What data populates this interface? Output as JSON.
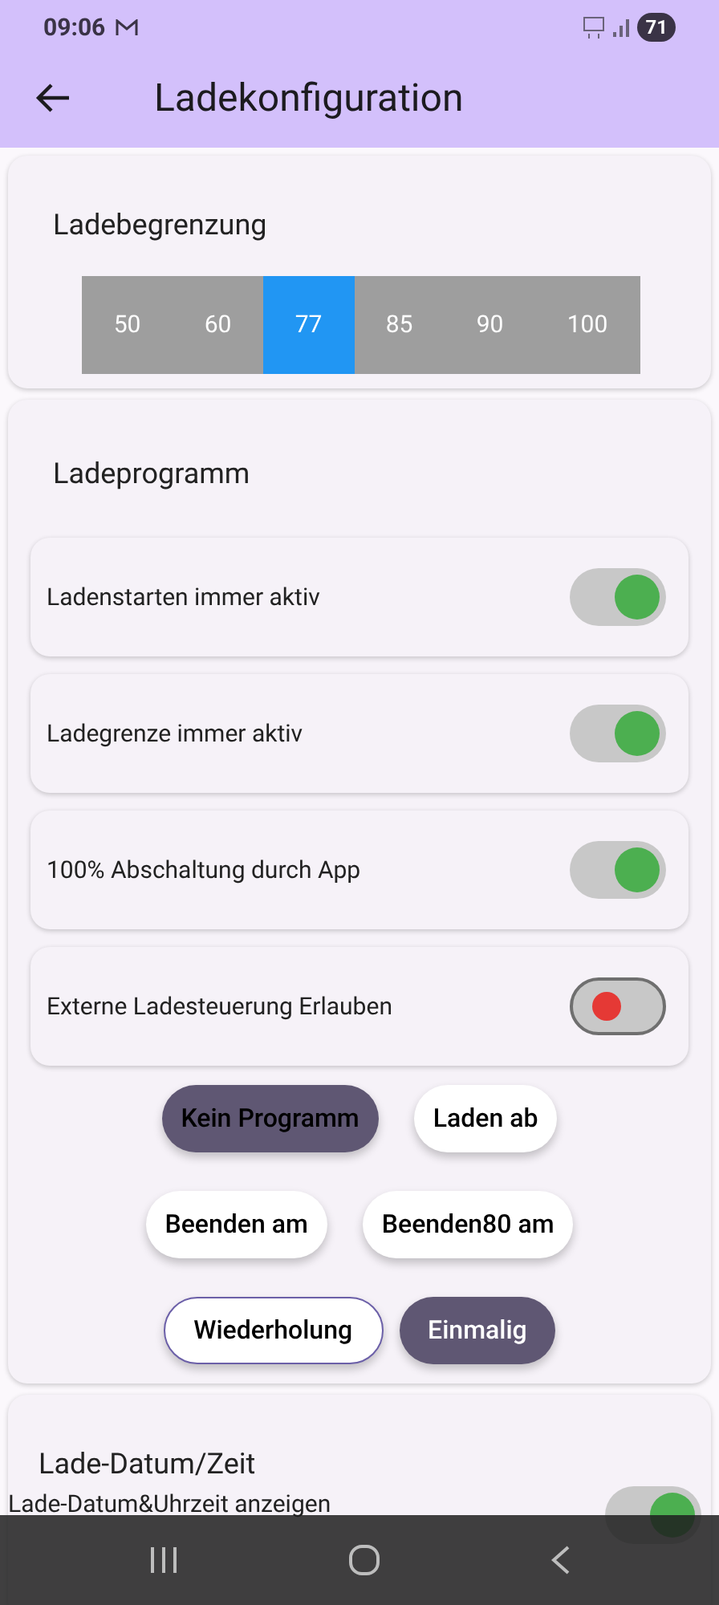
{
  "status_bar": {
    "time": "09:06",
    "battery": "71"
  },
  "app_bar": {
    "title": "Ladekonfiguration"
  },
  "charge_limit": {
    "title": "Ladebegrenzung",
    "options": [
      {
        "label": "50",
        "selected": false
      },
      {
        "label": "60",
        "selected": false
      },
      {
        "label": "77",
        "selected": true
      },
      {
        "label": "85",
        "selected": false
      },
      {
        "label": "90",
        "selected": false
      },
      {
        "label": "100",
        "selected": false
      }
    ]
  },
  "charge_program": {
    "title": "Ladeprogramm",
    "switches": [
      {
        "label": "Ladenstarten immer aktiv",
        "on": true
      },
      {
        "label": "Ladegrenze immer aktiv",
        "on": true
      },
      {
        "label": "100% Abschaltung durch App",
        "on": true
      },
      {
        "label": "Externe Ladesteuerung Erlauben",
        "on": false
      }
    ],
    "programs": [
      {
        "label": "Kein Programm",
        "selected": true
      },
      {
        "label": "Laden ab",
        "selected": false
      },
      {
        "label": "Beenden am",
        "selected": false
      },
      {
        "label": "Beenden80 am",
        "selected": false
      }
    ],
    "modes": [
      {
        "label": "Wiederholung",
        "selected": false
      },
      {
        "label": "Einmalig",
        "selected": true
      }
    ]
  },
  "date_time": {
    "title": "Lade-Datum/Zeit",
    "switches": [
      {
        "label": "Lade-Datum&Uhrzeit anzeigen",
        "on": true
      }
    ]
  }
}
